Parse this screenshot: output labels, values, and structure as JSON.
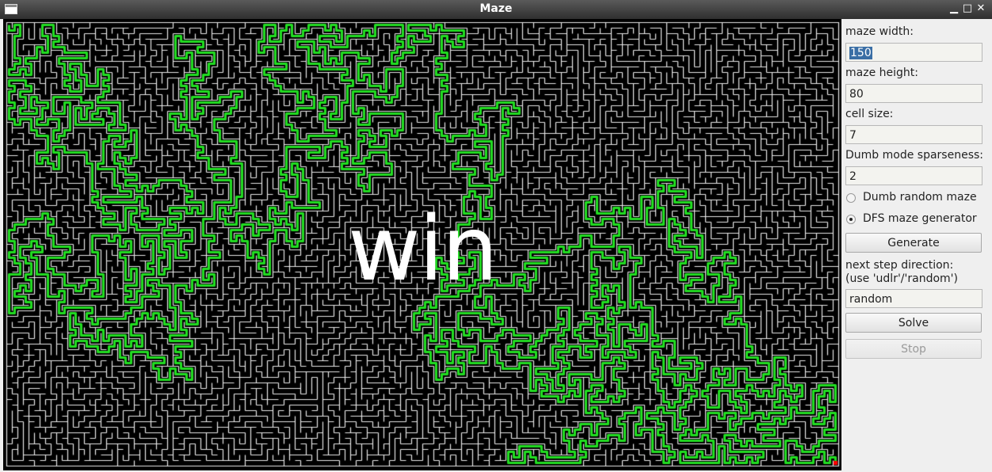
{
  "window": {
    "title": "Maze"
  },
  "maze": {
    "overlay_text": "win",
    "colors": {
      "background": "#000000",
      "walls": "#e6e6e6",
      "path": "#22dd22",
      "goal": "#ff0000"
    }
  },
  "panel": {
    "width_label": "maze width:",
    "width_value": "150",
    "height_label": "maze height:",
    "height_value": "80",
    "cell_label": "cell size:",
    "cell_value": "7",
    "sparse_label": "Dumb mode sparseness:",
    "sparse_value": "2",
    "radio_dumb": "Dumb random maze",
    "radio_dfs": "DFS maze generator",
    "selected_mode": "DFS maze generator",
    "generate_label": "Generate",
    "direction_label_1": "next step direction:",
    "direction_label_2": "(use 'udlr'/'random')",
    "direction_value": "random",
    "solve_label": "Solve",
    "stop_label": "Stop"
  }
}
